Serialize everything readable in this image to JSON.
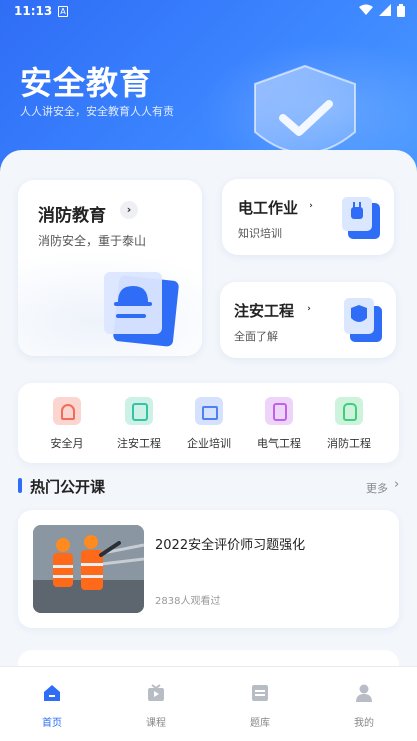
{
  "status_bar": {
    "time": "11:13",
    "sim_label": "A"
  },
  "header": {
    "title": "安全教育",
    "subtitle": "人人讲安全，安全教育人人有责"
  },
  "feature_cards": {
    "fire": {
      "title": "消防教育",
      "subtitle": "消防安全，重于泰山",
      "chevron": "›"
    },
    "electric": {
      "title": "电工作业",
      "subtitle": "知识培训",
      "chevron": "›"
    },
    "safety_eng": {
      "title": "注安工程",
      "subtitle": "全面了解",
      "chevron": "›"
    }
  },
  "quick_links": [
    {
      "label": "安全月",
      "color": "#f26b5b"
    },
    {
      "label": "注安工程",
      "color": "#34c3a5"
    },
    {
      "label": "企业培训",
      "color": "#4f7ff5"
    },
    {
      "label": "电气工程",
      "color": "#c062e8"
    },
    {
      "label": "消防工程",
      "color": "#3fcf7a"
    }
  ],
  "section": {
    "title": "热门公开课",
    "more": "更多",
    "more_chevron": "›"
  },
  "courses": [
    {
      "title": "2022安全评价师习题强化",
      "views": "2838人观看过"
    }
  ],
  "tabbar": {
    "items": [
      {
        "label": "首页",
        "icon": "home-icon",
        "active": true
      },
      {
        "label": "课程",
        "icon": "video-icon",
        "active": false
      },
      {
        "label": "题库",
        "icon": "question-bank-icon",
        "active": false
      },
      {
        "label": "我的",
        "icon": "user-icon",
        "active": false
      }
    ]
  },
  "colors": {
    "primary": "#2f6df6",
    "background": "#f3f6fb"
  }
}
